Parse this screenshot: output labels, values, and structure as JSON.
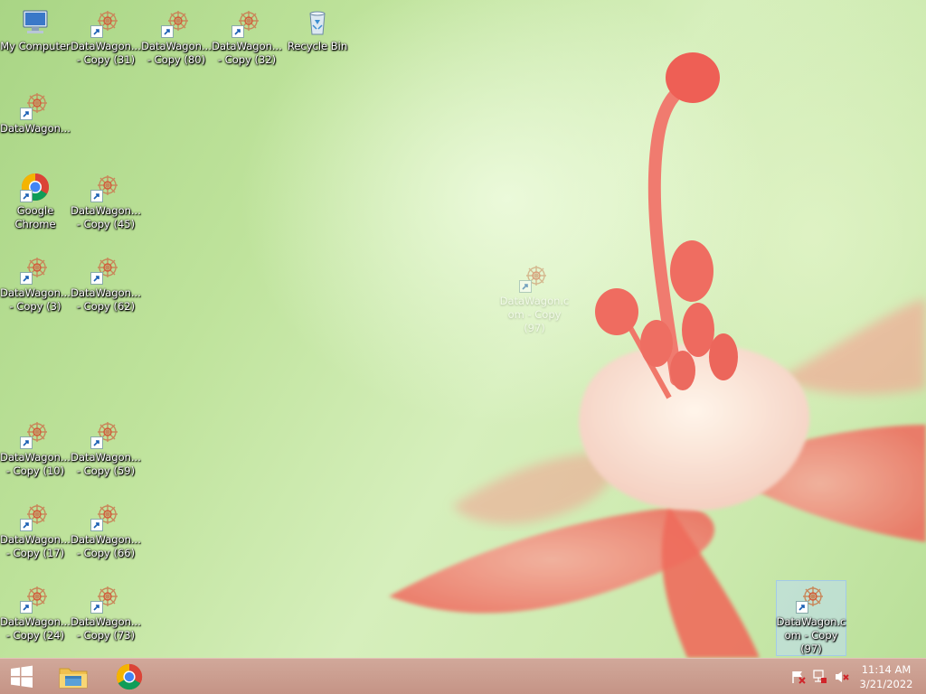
{
  "desktop": {
    "icons": [
      {
        "label": "My Computer"
      },
      {
        "label": "DataWagon... - Copy (31)"
      },
      {
        "label": "DataWagon... - Copy (80)"
      },
      {
        "label": "DataWagon... - Copy (32)"
      },
      {
        "label": "Recycle Bin"
      },
      {
        "label": "DataWagon..."
      },
      {
        "label": "Google Chrome"
      },
      {
        "label": "DataWagon... - Copy (45)"
      },
      {
        "label": "DataWagon... - Copy (3)"
      },
      {
        "label": "DataWagon... - Copy (62)"
      },
      {
        "label": "DataWagon... - Copy (10)"
      },
      {
        "label": "DataWagon... - Copy (59)"
      },
      {
        "label": "DataWagon... - Copy (17)"
      },
      {
        "label": "DataWagon... - Copy (66)"
      },
      {
        "label": "DataWagon... - Copy (24)"
      },
      {
        "label": "DataWagon... - Copy (73)"
      },
      {
        "label": "DataWagon.com - Copy (97)"
      },
      {
        "label": "DataWagon.com - Copy (97)"
      }
    ]
  },
  "taskbar": {
    "clock_time": "11:14 AM",
    "clock_date": "3/21/2022"
  },
  "colors": {
    "taskbar": "#c89a8b",
    "selection": "#bedcf5"
  }
}
